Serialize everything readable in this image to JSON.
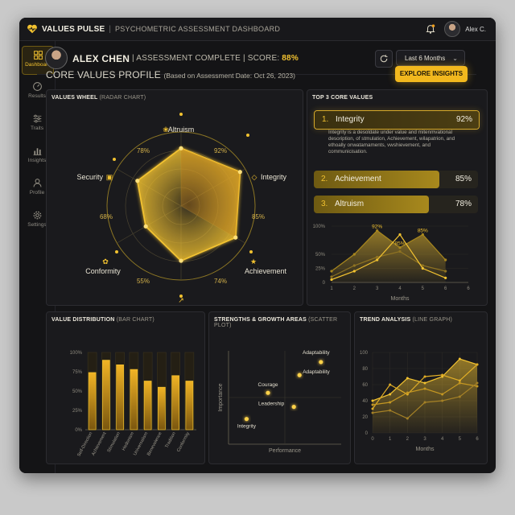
{
  "app": {
    "name": "VALUES PULSE",
    "subtitle": "PSYCHOMETRIC ASSESSMENT DASHBOARD",
    "user": "Alex C.",
    "accent": "#f2c230"
  },
  "sidebar": {
    "items": [
      {
        "label": "Dashboard",
        "icon": "dashboard-icon",
        "active": true
      },
      {
        "label": "Results",
        "icon": "gauge-icon"
      },
      {
        "label": "Traits",
        "icon": "sliders-icon"
      },
      {
        "label": "Insights",
        "icon": "bar-chart-icon"
      },
      {
        "label": "Profile",
        "icon": "user-icon"
      },
      {
        "label": "Settings",
        "icon": "gear-icon"
      }
    ]
  },
  "header": {
    "name": "ALEX CHEN",
    "status": "ASSESSMENT COMPLETE",
    "score_label": "SCORE:",
    "score": "88%",
    "range": "Last 6 Months"
  },
  "page": {
    "title": "CORE VALUES PROFILE",
    "subtitle": "(Based on Assessment Date: Oct 26, 2023)",
    "explore": "EXPLORE INSIGHTS"
  },
  "radar": {
    "title": "VALUES WHEEL",
    "title_sub": "(RADAR CHART)",
    "axes": [
      {
        "name": "Altruism",
        "value": 78,
        "label": "78%"
      },
      {
        "name": "Integrity",
        "value": 92,
        "label": "92%"
      },
      {
        "name": "Achievement",
        "value": 85,
        "label": "85%"
      },
      {
        "name": "Self-Direction",
        "value": 74,
        "label": "74%"
      },
      {
        "name": "Conformity",
        "value": 55,
        "label": "55%"
      },
      {
        "name": "Security",
        "value": 68,
        "label": "68%"
      }
    ]
  },
  "top_values": {
    "title": "TOP 3 CORE VALUES",
    "items": [
      {
        "rank": "1.",
        "name": "Integrity",
        "pct": "92%",
        "value": 92
      },
      {
        "rank": "2.",
        "name": "Achievement",
        "pct": "85%",
        "value": 85
      },
      {
        "rank": "3.",
        "name": "Altruism",
        "pct": "78%",
        "value": 78
      }
    ],
    "description": "Integrity is a desoldate under value and mitenmvational desoription, of stmulation, Achievement, wilapatrion, and ethoally onwatamaments, vwshievement, and communicisation.",
    "mini_chart": {
      "yticks": [
        "100%",
        "50%",
        "25%",
        "0"
      ],
      "xticks": [
        "1",
        "2",
        "3",
        "4",
        "5",
        "6",
        "6"
      ],
      "xlabel": "Months",
      "labels": [
        "92%",
        "85%",
        "85%"
      ]
    }
  },
  "bar_chart": {
    "title": "VALUE DISTRIBUTION",
    "title_sub": "(BAR CHART)",
    "yticks": [
      "100%",
      "75%",
      "50%",
      "25%",
      "0%"
    ],
    "categories": [
      "Self-Direction",
      "Achievement",
      "Stimulation",
      "Hedonism",
      "Universalism",
      "Benevolence",
      "Tradition",
      "Conformity"
    ]
  },
  "scatter": {
    "title": "STRENGTHS & GROWTH AREAS",
    "title_sub": "(SCATTER PLOT)",
    "xlabel": "Performance",
    "ylabel": "Importance",
    "points": [
      "Adaptability",
      "Adaptability",
      "Courage",
      "Leadership",
      "Integrity"
    ]
  },
  "trend": {
    "title": "TREND ANALYSIS",
    "title_sub": "(LINE GRAPH)",
    "yticks": [
      "100",
      "80",
      "60",
      "40",
      "20",
      "0"
    ],
    "xticks": [
      "0",
      "1",
      "2",
      "3",
      "4",
      "5",
      "6"
    ],
    "xlabel": "Months"
  },
  "chart_data": [
    {
      "type": "radar",
      "title": "VALUES WHEEL",
      "categories": [
        "Altruism",
        "Integrity",
        "Achievement",
        "Self-Direction",
        "Conformity",
        "Security"
      ],
      "values": [
        78,
        92,
        85,
        74,
        55,
        68
      ],
      "ylim": [
        0,
        100
      ]
    },
    {
      "type": "area",
      "categories": [
        "1",
        "2",
        "3",
        "4",
        "5",
        "6"
      ],
      "series": [
        {
          "values": [
            20,
            50,
            92,
            62,
            85,
            40
          ]
        },
        {
          "values": [
            10,
            30,
            45,
            55,
            30,
            20
          ]
        },
        {
          "values": [
            5,
            20,
            40,
            85,
            25,
            8
          ]
        }
      ],
      "ylim": [
        0,
        100
      ],
      "xlabel": "Months"
    },
    {
      "type": "bar",
      "title": "VALUE DISTRIBUTION",
      "categories": [
        "Self-Direction",
        "Achievement",
        "Stimulation",
        "Hedonism",
        "Universalism",
        "Benevolence",
        "Tradition",
        "Conformity"
      ],
      "values": [
        74,
        90,
        84,
        78,
        63,
        55,
        70,
        63
      ],
      "ylim": [
        0,
        100
      ]
    },
    {
      "type": "scatter",
      "title": "STRENGTHS & GROWTH AREAS",
      "xlabel": "Performance",
      "ylabel": "Importance",
      "points": [
        {
          "label": "Adaptability",
          "x": 82,
          "y": 88
        },
        {
          "label": "Adaptability",
          "x": 63,
          "y": 74
        },
        {
          "label": "Courage",
          "x": 35,
          "y": 55
        },
        {
          "label": "Leadership",
          "x": 58,
          "y": 40
        },
        {
          "label": "Integrity",
          "x": 16,
          "y": 27
        }
      ]
    },
    {
      "type": "line",
      "title": "TREND ANALYSIS",
      "x": [
        0,
        1,
        2,
        3,
        4,
        5,
        6
      ],
      "series": [
        {
          "values": [
            40,
            48,
            68,
            62,
            70,
            92,
            85
          ]
        },
        {
          "values": [
            30,
            60,
            48,
            70,
            72,
            65,
            85
          ]
        },
        {
          "values": [
            35,
            38,
            50,
            55,
            48,
            62,
            58
          ]
        },
        {
          "values": [
            25,
            28,
            18,
            38,
            40,
            45,
            62
          ]
        }
      ],
      "ylim": [
        0,
        100
      ],
      "xlabel": "Months"
    }
  ]
}
